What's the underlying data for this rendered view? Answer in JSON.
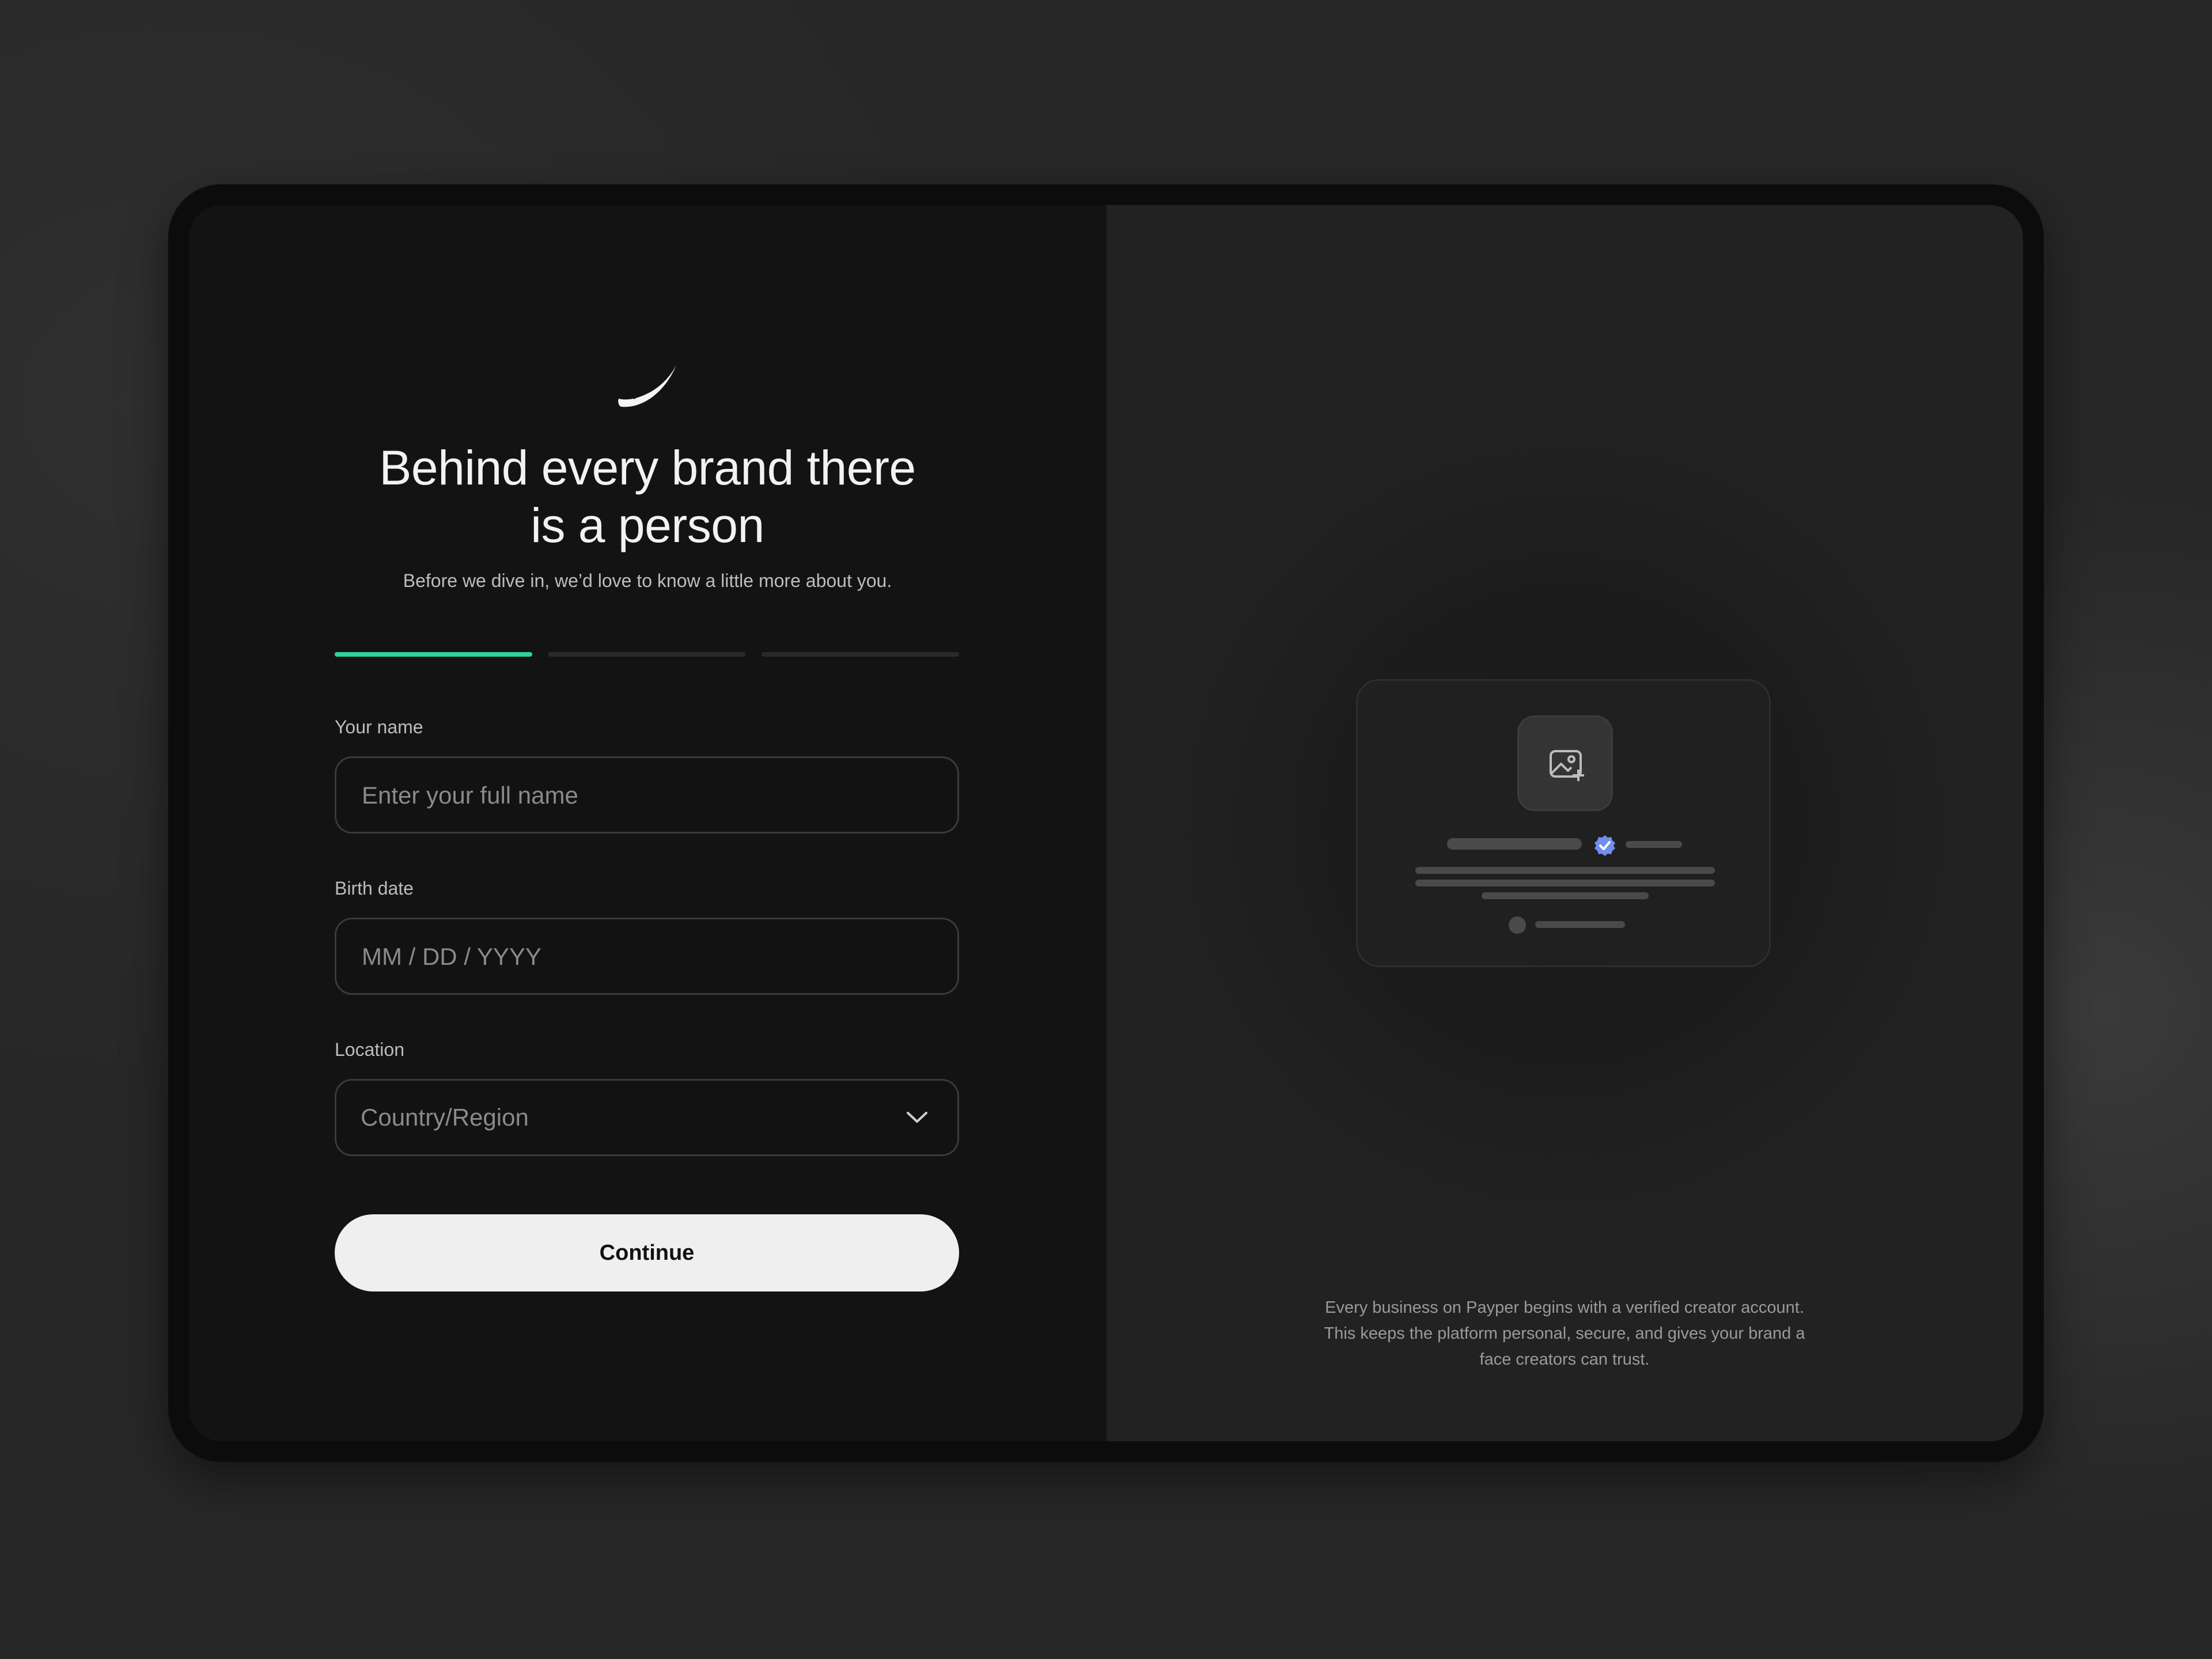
{
  "header": {
    "title_line1": "Behind every brand there",
    "title_line2": "is a person",
    "subtitle": "Before we dive in, we’d love to know a little more about you."
  },
  "progress": {
    "total_steps": 3,
    "current_step": 1,
    "active_color": "#2fd39b"
  },
  "form": {
    "name": {
      "label": "Your name",
      "placeholder": "Enter your full name",
      "value": ""
    },
    "birth_date": {
      "label": "Birth date",
      "placeholder": "MM / DD / YYYY",
      "value": ""
    },
    "location": {
      "label": "Location",
      "placeholder": "Country/Region",
      "icon": "chevron-down-icon"
    },
    "continue_label": "Continue"
  },
  "preview": {
    "upload_icon": "image-add-icon",
    "verified_icon": "verified-badge-icon",
    "verified_color": "#6f8ef0"
  },
  "footnote": {
    "line1": "Every business on Payper begins with a verified creator account.",
    "line2": "This keeps the platform personal, secure, and gives your brand a",
    "line3": "face creators can trust."
  },
  "logo": {
    "icon": "feather-logo-icon"
  }
}
